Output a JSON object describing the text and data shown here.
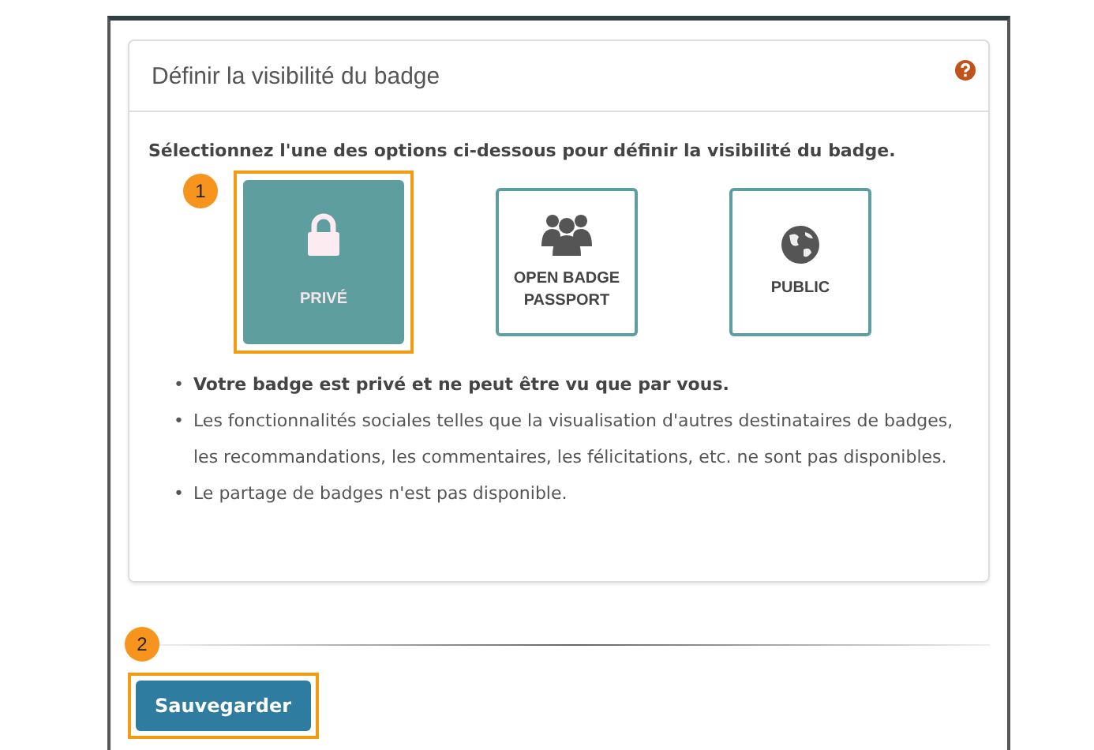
{
  "panel": {
    "title": "Définir la visibilité du badge"
  },
  "instruction": "Sélectionnez l'une des options ci-dessous pour définir la visibilité du badge.",
  "options": [
    {
      "kind": "lock",
      "label": "PRIVÉ",
      "selected": true,
      "callout": "1"
    },
    {
      "kind": "group",
      "label": "OPEN BADGE PASSPORT",
      "selected": false
    },
    {
      "kind": "globe",
      "label": "PUBLIC",
      "selected": false
    }
  ],
  "bullets": [
    {
      "marker": "•",
      "text": "Votre badge est privé et ne peut être vu que par vous.",
      "bold": true
    },
    {
      "marker": "•",
      "text": "Les fonctionnalités sociales telles que la visualisation d'autres destinataires de badges, les recommandations, les commentaires, les félicitations, etc. ne sont pas disponibles.",
      "bold": false
    },
    {
      "marker": "•",
      "text": "Le partage de badges n'est pas disponible.",
      "bold": false
    }
  ],
  "footer": {
    "callout": "2",
    "save_button": "Sauvegarder"
  }
}
